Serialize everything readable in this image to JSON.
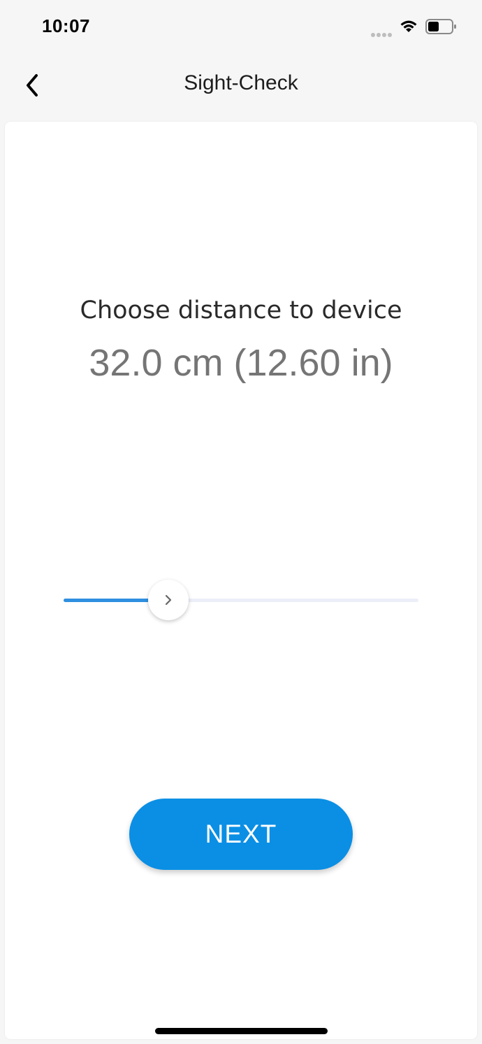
{
  "status_bar": {
    "time": "10:07"
  },
  "nav": {
    "back_icon": "chevron-left-icon",
    "title": "Sight-Check"
  },
  "main": {
    "prompt": "Choose distance to device",
    "distance_value": "32.0 cm (12.60 in)",
    "slider": {
      "level": 0.295,
      "thumb_icon": "chevron-right-icon"
    },
    "next_label": "NEXT"
  },
  "colors": {
    "accent": "#0a8fe5",
    "slider_fill": "#2f8fe0",
    "slider_track": "#eceef8",
    "value_text": "#757575"
  }
}
